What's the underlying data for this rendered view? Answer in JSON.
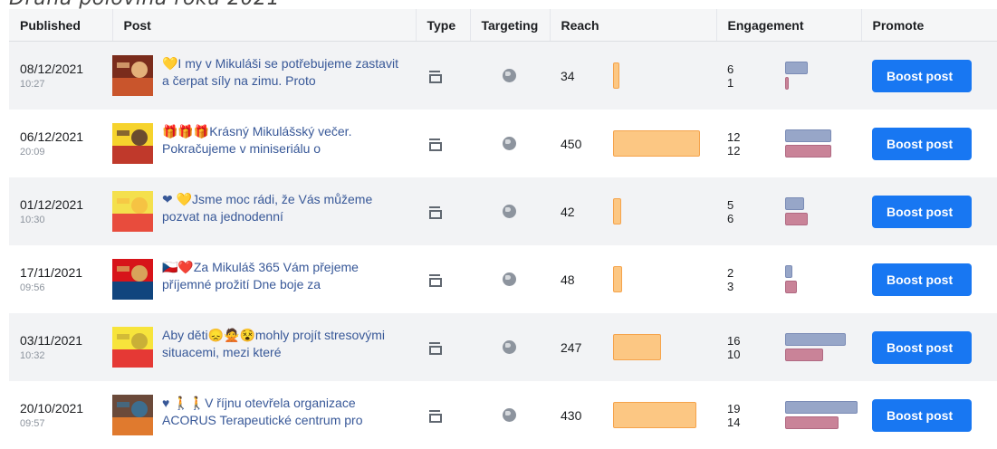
{
  "caption": "Druhá polovina roku 2021",
  "headers": {
    "published": "Published",
    "post": "Post",
    "type": "Type",
    "targeting": "Targeting",
    "reach": "Reach",
    "engagement": "Engagement",
    "promote": "Promote"
  },
  "boost_label": "Boost post",
  "reach_max": 450,
  "engagement_max": 19,
  "rows": [
    {
      "date": "08/12/2021",
      "time": "10:27",
      "text": "💛I my v Mikuláši se potřebujeme zastavit a čerpat síly na zimu. Proto",
      "thumb": [
        "#7a2c1c",
        "#c9552c",
        "#e3b07a"
      ],
      "reach": 34,
      "reach_label": "34",
      "eng1": 6,
      "eng2": 1,
      "eng1_label": "6",
      "eng2_label": "1"
    },
    {
      "date": "06/12/2021",
      "time": "20:09",
      "text": "🎁🎁🎁Krásný Mikulášský večer. Pokračujeme v miniseriálu o",
      "thumb": [
        "#f6d32d",
        "#c0392b",
        "#6b4b2f"
      ],
      "reach": 450,
      "reach_label": "450",
      "eng1": 12,
      "eng2": 12,
      "eng1_label": "12",
      "eng2_label": "12"
    },
    {
      "date": "01/12/2021",
      "time": "10:30",
      "text": "❤ 💛Jsme moc rádi, že Vás můžeme pozvat na jednodenní",
      "thumb": [
        "#f4e04d",
        "#e84c3d",
        "#f6c343"
      ],
      "reach": 42,
      "reach_label": "42",
      "eng1": 5,
      "eng2": 6,
      "eng1_label": "5",
      "eng2_label": "6"
    },
    {
      "date": "17/11/2021",
      "time": "09:56",
      "text": "🇨🇿❤️Za Mikuláš 365 Vám přejeme příjemné prožití Dne boje za",
      "thumb": [
        "#d7141a",
        "#11457e",
        "#d8a35a"
      ],
      "reach": 48,
      "reach_label": "48",
      "eng1": 2,
      "eng2": 3,
      "eng1_label": "2",
      "eng2_label": "3"
    },
    {
      "date": "03/11/2021",
      "time": "10:32",
      "text": "Aby děti😞🙅😵mohly projít stresovými situacemi, mezi které",
      "thumb": [
        "#f7e43b",
        "#e53935",
        "#c9b037"
      ],
      "reach": 247,
      "reach_label": "247",
      "eng1": 16,
      "eng2": 10,
      "eng1_label": "16",
      "eng2_label": "10"
    },
    {
      "date": "20/10/2021",
      "time": "09:57",
      "text": "♥ 🚶🚶V říjnu otevřela organizace ACORUS Terapeutické centrum pro",
      "thumb": [
        "#6b4a3a",
        "#e07a2e",
        "#3d6e8f"
      ],
      "reach": 430,
      "reach_label": "430",
      "eng1": 19,
      "eng2": 14,
      "eng1_label": "19",
      "eng2_label": "14"
    }
  ]
}
